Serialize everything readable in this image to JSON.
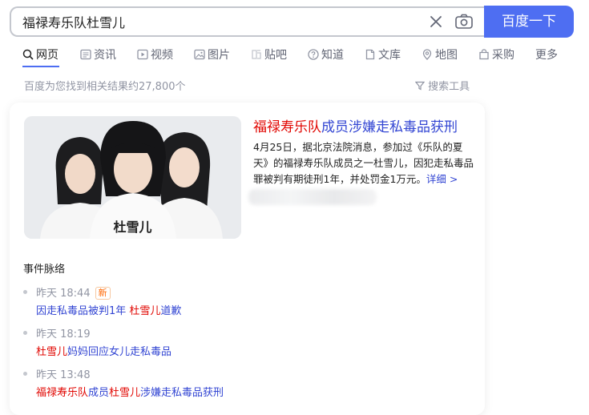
{
  "search": {
    "query": "福禄寿乐队杜雪儿",
    "button_label": "百度一下"
  },
  "tabs": [
    {
      "label": "网页",
      "icon": "search-icon"
    },
    {
      "label": "资讯",
      "icon": "news-icon"
    },
    {
      "label": "视频",
      "icon": "video-icon"
    },
    {
      "label": "图片",
      "icon": "image-icon"
    },
    {
      "label": "贴吧",
      "icon": "tieba-icon"
    },
    {
      "label": "知道",
      "icon": "question-icon"
    },
    {
      "label": "文库",
      "icon": "document-icon"
    },
    {
      "label": "地图",
      "icon": "map-pin-icon"
    },
    {
      "label": "采购",
      "icon": "cart-icon"
    },
    {
      "label": "更多",
      "icon": ""
    }
  ],
  "result_count": "百度为您找到相关结果约27,800个",
  "search_tools": "搜索工具",
  "news": {
    "image_caption": "杜雪儿",
    "title_highlight": "福禄寿乐队",
    "title_rest": "成员涉嫌走私毒品获刑",
    "body": "4月25日，据北京法院消息，参加过《乐队的夏天》的福禄寿乐队成员之一杜雪儿，因犯走私毒品罪被判有期徒刑1年，并处罚金1万元。",
    "more": "详细 >"
  },
  "timeline": {
    "title": "事件脉络",
    "new_badge": "新",
    "events": [
      {
        "time": "昨天 18:44",
        "parts": [
          {
            "t": "因走私毒品被判1年 "
          },
          {
            "t": "杜雪儿",
            "hl": true
          },
          {
            "t": "道歉"
          }
        ]
      },
      {
        "time": "昨天 18:19",
        "parts": [
          {
            "t": "杜雪儿",
            "hl": true
          },
          {
            "t": "妈妈回应女儿走私毒品"
          }
        ]
      },
      {
        "time": "昨天 13:48",
        "parts": [
          {
            "t": "福禄寿乐队",
            "hl": true
          },
          {
            "t": "成员"
          },
          {
            "t": "杜雪儿",
            "hl": true
          },
          {
            "t": "涉嫌走私毒品获刑"
          }
        ]
      }
    ]
  },
  "colors": {
    "accent": "#4e6ef2",
    "highlight": "#e10601",
    "link": "#3346d3"
  }
}
